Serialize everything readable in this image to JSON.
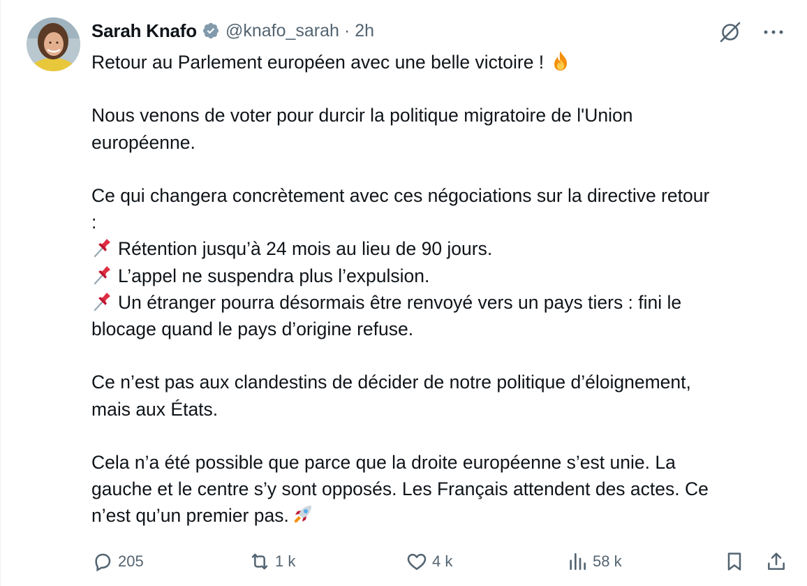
{
  "author": {
    "display_name": "Sarah Knafo",
    "handle": "@knafo_sarah",
    "separator": "·",
    "time": "2h",
    "verified_color": "#829aab"
  },
  "tweet": {
    "lines": [
      {
        "text": "Retour au Parlement européen avec une belle victoire !",
        "emoji_after": "fire-emoji"
      },
      {
        "text": "Nous venons de voter pour durcir la politique migratoire de l'Union"
      },
      {
        "text": "européenne."
      },
      {
        "text": "Ce qui changera concrètement avec ces négociations sur la directive retour"
      },
      {
        "text": ":"
      },
      {
        "text": "Rétention jusqu’à 24 mois au lieu de 90 jours.",
        "emoji_before": "pushpin-emoji"
      },
      {
        "text": "L’appel ne suspendra plus l’expulsion.",
        "emoji_before": "pushpin-emoji"
      },
      {
        "text": "Un étranger pourra désormais être renvoyé vers un pays tiers : fini le",
        "emoji_before": "pushpin-emoji"
      },
      {
        "text": "blocage quand le pays d’origine refuse."
      },
      {
        "text": "Ce n’est pas aux clandestins de décider de notre politique d’éloignement,"
      },
      {
        "text": "mais aux États."
      },
      {
        "text": "Cela n’a été possible que parce que la droite européenne s’est unie. La"
      },
      {
        "text": "gauche et le centre s’y sont opposés. Les Français attendent des actes. Ce"
      },
      {
        "text": "n’est qu’un premier pas.",
        "emoji_after": "rocket-emoji"
      }
    ]
  },
  "actions": {
    "replies": "205",
    "reposts": "1 k",
    "likes": "4 k",
    "views": "58 k"
  },
  "colors": {
    "text": "#0f1419",
    "muted": "#536471"
  }
}
